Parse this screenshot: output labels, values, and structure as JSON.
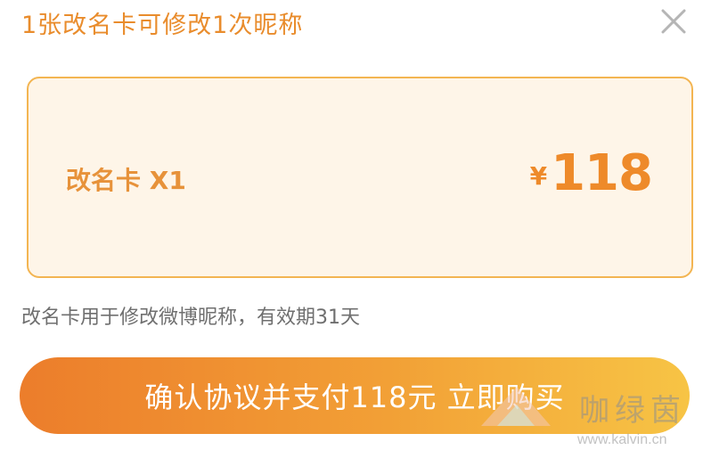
{
  "header": {
    "title": "1张改名卡可修改1次昵称",
    "close_icon": "close-icon"
  },
  "card": {
    "label": "改名卡 X1",
    "currency_symbol": "¥",
    "price": "118"
  },
  "description": "改名卡用于修改微博昵称，有效期31天",
  "pay_button": {
    "label": "确认协议并支付118元 立即购买"
  },
  "watermark": {
    "name": "咖绿茵",
    "url": "www.kalvin.cn"
  },
  "colors": {
    "accent": "#e98c2c",
    "card_border": "#f3b552",
    "card_bg": "#fef5e8",
    "button_start": "#ec7d2b",
    "button_end": "#f7c445"
  }
}
